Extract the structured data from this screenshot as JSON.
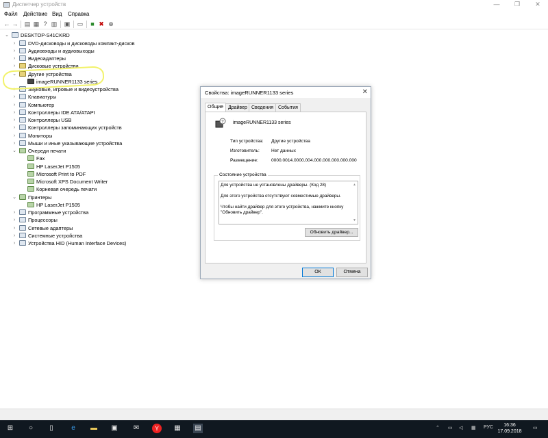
{
  "window": {
    "title": "Диспетчер устройств",
    "controls": [
      "—",
      "❐",
      "✕"
    ]
  },
  "menu": [
    "Файл",
    "Действие",
    "Вид",
    "Справка"
  ],
  "tree": {
    "root": "DESKTOP-S41CKRD",
    "items": [
      {
        "label": "DVD-дисководы и дисководы компакт-дисков",
        "level": 1,
        "expander": "›",
        "icon": "dvd-drive-icon"
      },
      {
        "label": "Аудиовходы и аудиовыходы",
        "level": 1,
        "expander": "›",
        "icon": "speaker-icon"
      },
      {
        "label": "Видеоадаптеры",
        "level": 1,
        "expander": "›",
        "icon": "display-adapter-icon"
      },
      {
        "label": "Дисковые устройства",
        "level": 1,
        "expander": "›",
        "icon": "disk-drive-icon"
      },
      {
        "label": "Другие устройства",
        "level": 1,
        "expander": "⌄",
        "icon": "unknown-device-icon"
      },
      {
        "label": "imageRUNNER1133 series",
        "level": 2,
        "expander": "",
        "icon": "warning-device-icon"
      },
      {
        "label": "Звуковые, игровые и видеоустройства",
        "level": 1,
        "expander": "›",
        "icon": "sound-device-icon"
      },
      {
        "label": "Клавиатуры",
        "level": 1,
        "expander": "›",
        "icon": "keyboard-icon"
      },
      {
        "label": "Компьютер",
        "level": 1,
        "expander": "›",
        "icon": "computer-icon"
      },
      {
        "label": "Контроллеры IDE ATA/ATAPI",
        "level": 1,
        "expander": "›",
        "icon": "ide-controller-icon"
      },
      {
        "label": "Контроллеры USB",
        "level": 1,
        "expander": "›",
        "icon": "usb-controller-icon"
      },
      {
        "label": "Контроллеры запоминающих устройств",
        "level": 1,
        "expander": "›",
        "icon": "storage-controller-icon"
      },
      {
        "label": "Мониторы",
        "level": 1,
        "expander": "›",
        "icon": "monitor-icon"
      },
      {
        "label": "Мыши и иные указывающие устройства",
        "level": 1,
        "expander": "›",
        "icon": "mouse-icon"
      },
      {
        "label": "Очереди печати",
        "level": 1,
        "expander": "⌄",
        "icon": "print-queue-icon"
      },
      {
        "label": "Fax",
        "level": 2,
        "expander": "",
        "icon": "printer-icon"
      },
      {
        "label": "HP LaserJet P1505",
        "level": 2,
        "expander": "",
        "icon": "printer-icon"
      },
      {
        "label": "Microsoft Print to PDF",
        "level": 2,
        "expander": "",
        "icon": "printer-icon"
      },
      {
        "label": "Microsoft XPS Document Writer",
        "level": 2,
        "expander": "",
        "icon": "printer-icon"
      },
      {
        "label": "Корневая очередь печати",
        "level": 2,
        "expander": "",
        "icon": "printer-icon"
      },
      {
        "label": "Принтеры",
        "level": 1,
        "expander": "⌄",
        "icon": "printers-icon"
      },
      {
        "label": "HP LaserJet P1505",
        "level": 2,
        "expander": "",
        "icon": "printer-icon"
      },
      {
        "label": "Программные устройства",
        "level": 1,
        "expander": "›",
        "icon": "software-device-icon"
      },
      {
        "label": "Процессоры",
        "level": 1,
        "expander": "›",
        "icon": "cpu-icon"
      },
      {
        "label": "Сетевые адаптеры",
        "level": 1,
        "expander": "›",
        "icon": "network-adapter-icon"
      },
      {
        "label": "Системные устройства",
        "level": 1,
        "expander": "›",
        "icon": "system-device-icon"
      },
      {
        "label": "Устройства HID (Human Interface Devices)",
        "level": 1,
        "expander": "›",
        "icon": "hid-icon"
      }
    ]
  },
  "dialog": {
    "title": "Свойства: imageRUNNER1133 series",
    "close": "✕",
    "tabs": [
      "Общие",
      "Драйвер",
      "Сведения",
      "События"
    ],
    "device_name": "imageRUNNER1133 series",
    "props": [
      {
        "label": "Тип устройства:",
        "value": "Другие устройства"
      },
      {
        "label": "Изготовитель:",
        "value": "Нет данных"
      },
      {
        "label": "Размещение:",
        "value": "0000.0014.0000.004.000.000.000.000.000"
      }
    ],
    "status_group": "Состояние устройства",
    "status_lines": [
      "Для устройства не установлены драйверы. (Код 28)",
      "Для этого устройства отсутствуют совместимые драйверы.",
      "Чтобы найти драйвер для этого устройства, нажмите кнопку \"Обновить драйвер\"."
    ],
    "update_driver_button": "Обновить драйвер...",
    "ok_button": "ОК",
    "cancel_button": "Отмена"
  },
  "taskbar": {
    "language": "РУС",
    "time": "16:36",
    "date": "17.09.2018",
    "browser_badge": "Y"
  },
  "colors": {
    "highlight": "#f2f26a",
    "taskbar": "#101820",
    "accent": "#0078d7"
  }
}
